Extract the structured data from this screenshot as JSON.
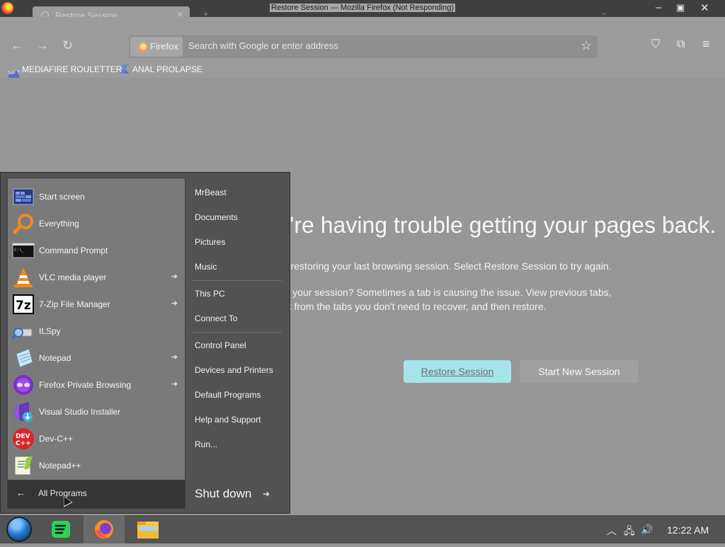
{
  "window": {
    "title": "Restore Session — Mozilla Firefox (Not Responding)",
    "tab_label": "Restore Session",
    "tab_close": "×",
    "new_tab": "+",
    "tab_list": "⌄",
    "minimize": "–",
    "maximize": "▣",
    "close": "✕"
  },
  "nav": {
    "back": "←",
    "forward": "→",
    "reload": "↻",
    "identity_label": "Firefox",
    "url_placeholder": "Search with Google or enter address",
    "bookmark_star": "☆",
    "pocket": "⛉",
    "extensions": "⧉",
    "menu": "≡"
  },
  "bookmarks": [
    {
      "label": "MEDIAFIRE ROULETTER",
      "icon": "MF T"
    },
    {
      "label": "ANAL PROLAPSE",
      "icon": "bookmark-icon"
    }
  ],
  "page": {
    "heading": "Sorry. We're having trouble getting your pages back.",
    "p1": "We are having trouble restoring your last browsing session. Select Restore Session to try again.",
    "p2": "Still not able to restore your session? Sometimes a tab is causing the issue. View previous tabs, remove the checkmark from the tabs you don't need to recover, and then restore.",
    "restore_button": "Restore Session",
    "new_session_button": "Start New Session"
  },
  "start_menu": {
    "programs": [
      {
        "label": "Start screen",
        "icon": "start-screen-icon",
        "has_submenu": false
      },
      {
        "label": "Everything",
        "icon": "magnifier-icon",
        "has_submenu": false
      },
      {
        "label": "Command Prompt",
        "icon": "cmd-icon",
        "has_submenu": false
      },
      {
        "label": "VLC media player",
        "icon": "vlc-cone-icon",
        "has_submenu": true
      },
      {
        "label": "7-Zip File Manager",
        "icon": "7zip-icon",
        "has_submenu": true
      },
      {
        "label": "ILSpy",
        "icon": "ilspy-icon",
        "has_submenu": false
      },
      {
        "label": "Notepad",
        "icon": "notepad-icon",
        "has_submenu": true
      },
      {
        "label": "Firefox Private Browsing",
        "icon": "firefox-private-icon",
        "has_submenu": true
      },
      {
        "label": "Visual Studio Installer",
        "icon": "visual-studio-installer-icon",
        "has_submenu": false
      },
      {
        "label": "Dev-C++",
        "icon": "devcpp-icon",
        "has_submenu": false
      },
      {
        "label": "Notepad++",
        "icon": "notepadpp-icon",
        "has_submenu": false
      }
    ],
    "submenu_arrow": "➜",
    "all_programs_back": "←",
    "all_programs": "All Programs",
    "places": [
      "MrBeast",
      "Documents",
      "Pictures",
      "Music",
      "This PC",
      "Connect To",
      "Control Panel",
      "Devices and Printers",
      "Default Programs",
      "Help and Support",
      "Run..."
    ],
    "shutdown": "Shut down",
    "shutdown_arrow": "➜"
  },
  "taskbar": {
    "apps": [
      "start-orb",
      "spotify-icon",
      "firefox-icon",
      "file-explorer-icon"
    ],
    "tray_chevron": "︿",
    "tray_network": "🖧",
    "tray_volume": "🔊",
    "clock": "12:22 AM"
  }
}
